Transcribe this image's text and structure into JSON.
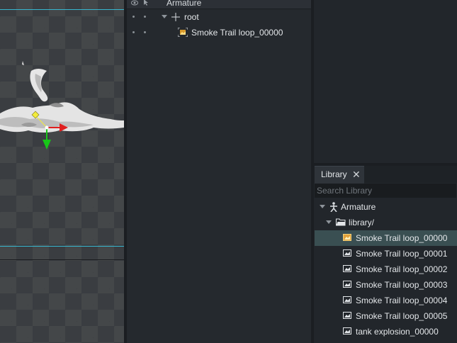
{
  "scene_tree": {
    "header": {
      "title": "Armature",
      "eye_icon": "eye-icon",
      "cursor_icon": "cursor-icon"
    },
    "rows": [
      {
        "label": "root",
        "icon": "bone-cross-icon",
        "expanded": true
      },
      {
        "label": "Smoke Trail loop_00000",
        "icon": "image-slot-icon"
      }
    ]
  },
  "library": {
    "tab_label": "Library",
    "close_icon": "close-icon",
    "search_placeholder": "Search Library",
    "items": [
      {
        "label": "Armature",
        "icon": "armature-figure-icon"
      },
      {
        "label": "library/",
        "icon": "folder-open-icon"
      },
      {
        "label": "Smoke Trail loop_00000",
        "icon": "image-icon",
        "selected": true
      },
      {
        "label": "Smoke Trail loop_00001",
        "icon": "image-icon"
      },
      {
        "label": "Smoke Trail loop_00002",
        "icon": "image-icon"
      },
      {
        "label": "Smoke Trail loop_00003",
        "icon": "image-icon"
      },
      {
        "label": "Smoke Trail loop_00004",
        "icon": "image-icon"
      },
      {
        "label": "Smoke Trail loop_00005",
        "icon": "image-icon"
      },
      {
        "label": "tank explosion_00000",
        "icon": "image-icon"
      }
    ]
  },
  "colors": {
    "stage_boundary": "#37b7cf",
    "selection": "#3a4f52",
    "gizmo_x": "#e02020",
    "gizmo_y": "#18c718",
    "pivot": "#f2ec3a"
  }
}
